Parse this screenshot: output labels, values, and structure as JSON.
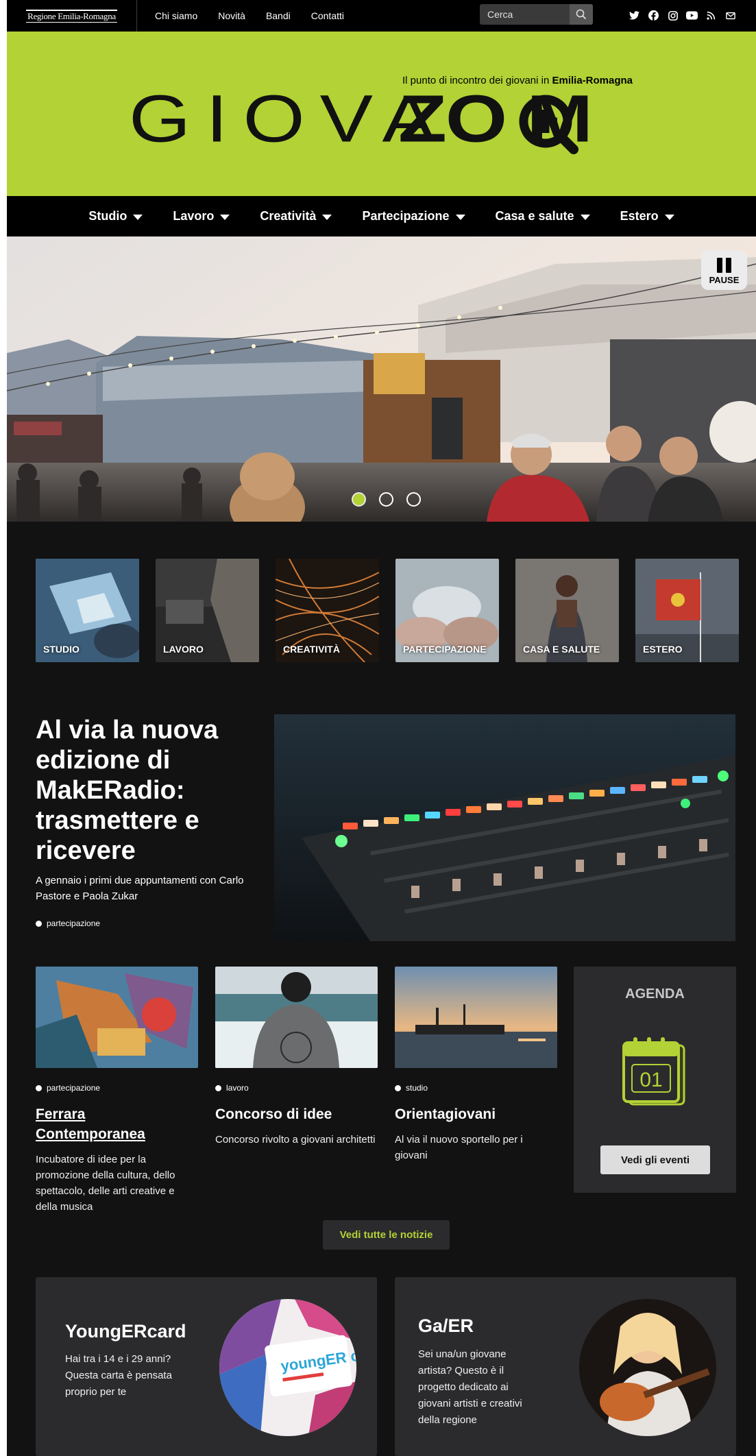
{
  "topbar": {
    "logo_text": "Regione Emilia-Romagna",
    "nav": [
      "Chi siamo",
      "Novità",
      "Bandi",
      "Contatti"
    ],
    "search_placeholder": "Cerca",
    "social_icons": [
      "twitter-icon",
      "facebook-icon",
      "instagram-icon",
      "youtube-icon",
      "rss-icon",
      "mail-icon"
    ]
  },
  "brand": {
    "tagline_prefix": "Il punto di incontro dei giovani in ",
    "tagline_bold": "Emilia-Romagna",
    "word_light": "GIOVA",
    "word_bold": "ZO  M",
    "color": "#b2d235"
  },
  "mainnav": [
    "Studio",
    "Lavoro",
    "Creatività",
    "Partecipazione",
    "Casa e salute",
    "Estero"
  ],
  "slider": {
    "pause_label": "PAUSE",
    "slides": 3,
    "active_slide": 1
  },
  "categories": [
    "STUDIO",
    "LAVORO",
    "CREATIVITÀ",
    "PARTECIPAZIONE",
    "CASA E SALUTE",
    "ESTERO"
  ],
  "feature": {
    "title": "Al via la nuova edizione di MakERadio: trasmettere e ricevere",
    "subtitle": "A gennaio i primi due appuntamenti con Carlo Pastore e Paola Zukar",
    "tag": "partecipazione"
  },
  "news": [
    {
      "tag": "partecipazione",
      "title": "Ferrara Contemporanea",
      "text": "Incubatore di idee per la promozione della cultura, dello spettacolo, delle arti creative e della musica"
    },
    {
      "tag": "lavoro",
      "title": "Concorso di idee",
      "text": "Concorso rivolto a giovani architetti"
    },
    {
      "tag": "studio",
      "title": "Orientagiovani",
      "text": "Al via il nuovo sportello per i giovani"
    }
  ],
  "agenda": {
    "heading": "AGENDA",
    "calendar_day": "01",
    "button": "Vedi gli eventi"
  },
  "all_news_button": "Vedi tutte le notizie",
  "promos": [
    {
      "title": "YoungERcard",
      "text": "Hai tra i 14 e i 29 anni? Questa carta è pensata proprio per te",
      "card_text": "youngER card"
    },
    {
      "title": "Ga/ER",
      "text": "Sei una/un giovane artista? Questo è il progetto dedicato ai giovani artisti e creativi della regione"
    }
  ]
}
